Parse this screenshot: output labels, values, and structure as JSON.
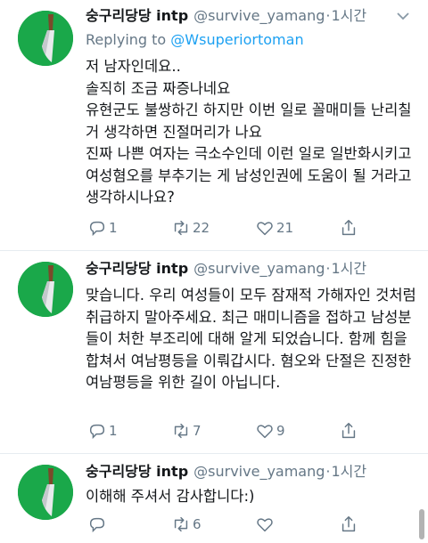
{
  "tweets": [
    {
      "name": "숭구리당당 intp",
      "handle": "@survive_yamang",
      "separator": "·",
      "time": "1시간",
      "reply_prefix": "Replying to ",
      "reply_target": "@Wsuperiortoman",
      "text": "저 남자인데요..\n솔직히 조금 짜증나네요\n유현군도 불쌍하긴 하지만 이번 일로 꼴매미들 난리칠 거 생각하면 진절머리가 나요\n진짜 나쁜 여자는 극소수인데 이런 일로 일반화시키고 여성혐오를 부추기는 게 남성인권에 도움이 될 거라고 생각하시나요?",
      "replies": "1",
      "retweets": "22",
      "likes": "21"
    },
    {
      "name": "숭구리당당 intp",
      "handle": "@survive_yamang",
      "separator": "·",
      "time": "1시간",
      "text": "맞습니다. 우리 여성들이 모두 잠재적 가해자인 것처럼 취급하지 말아주세요. 최근 매미니즘을 접하고 남성분들이 처한 부조리에 대해 알게 되었습니다. 함께 힘을 합쳐서 여남평등을 이뤄갑시다. 혐오와 단절은 진정한 여남평등을 위한 길이 아닙니다.",
      "replies": "1",
      "retweets": "7",
      "likes": "9"
    },
    {
      "name": "숭구리당당 intp",
      "handle": "@survive_yamang",
      "separator": "·",
      "time": "1시간",
      "text": "이해해 주셔서 감사합니다:)",
      "replies": "",
      "retweets": "6",
      "likes": ""
    }
  ],
  "icons": {
    "reply": "reply-icon",
    "retweet": "retweet-icon",
    "like": "heart-icon",
    "share": "share-icon",
    "more": "chevron-down-icon"
  },
  "colors": {
    "link": "#1da1f2",
    "secondary": "#657786",
    "avatar_bg": "#1aa84a"
  }
}
